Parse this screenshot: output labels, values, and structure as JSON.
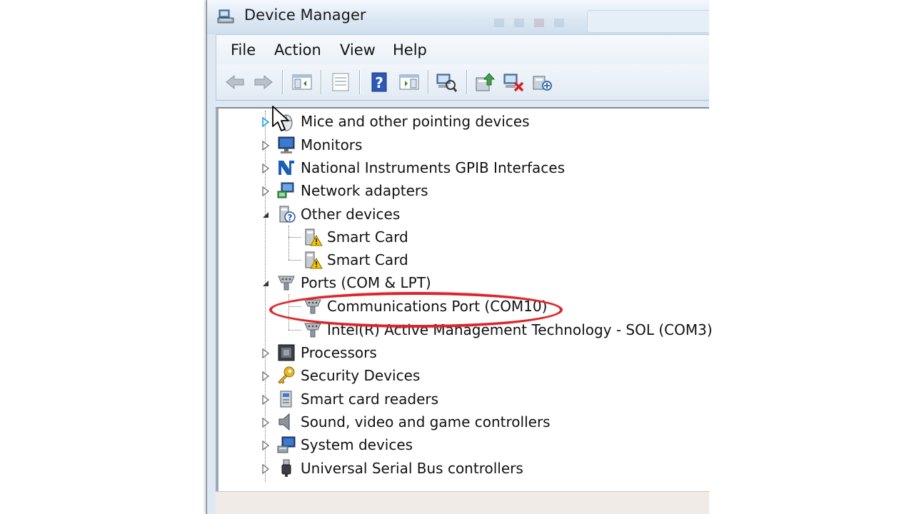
{
  "window": {
    "title": "Device Manager"
  },
  "menu": [
    "File",
    "Action",
    "View",
    "Help"
  ],
  "toolbar": {
    "buttons": [
      "back-icon",
      "forward-icon",
      "show-hide-console-tree-icon",
      "properties-icon",
      "help-icon",
      "action-pane-icon",
      "scan-hardware-changes-icon",
      "update-driver-icon",
      "disable-device-icon",
      "uninstall-device-icon"
    ]
  },
  "tree": {
    "items": [
      {
        "label": "Mice and other pointing devices",
        "icon": "mouse-icon",
        "expanded": false
      },
      {
        "label": "Monitors",
        "icon": "monitor-icon",
        "expanded": false
      },
      {
        "label": "National Instruments GPIB Interfaces",
        "icon": "ni-logo-icon",
        "expanded": false
      },
      {
        "label": "Network adapters",
        "icon": "network-adapter-icon",
        "expanded": false
      },
      {
        "label": "Other devices",
        "icon": "unknown-device-icon",
        "expanded": true,
        "children": [
          {
            "label": "Smart Card",
            "icon": "warning-device-icon"
          },
          {
            "label": "Smart Card",
            "icon": "warning-device-icon"
          }
        ]
      },
      {
        "label": "Ports (COM & LPT)",
        "icon": "port-icon",
        "expanded": true,
        "children": [
          {
            "label": "Communications Port (COM10)",
            "icon": "port-icon",
            "highlighted": true
          },
          {
            "label": "Intel(R) Active Management Technology - SOL (COM3)",
            "icon": "port-icon"
          }
        ]
      },
      {
        "label": "Processors",
        "icon": "processor-icon",
        "expanded": false
      },
      {
        "label": "Security Devices",
        "icon": "key-icon",
        "expanded": false
      },
      {
        "label": "Smart card readers",
        "icon": "card-reader-icon",
        "expanded": false
      },
      {
        "label": "Sound, video and game controllers",
        "icon": "speaker-icon",
        "expanded": false
      },
      {
        "label": "System devices",
        "icon": "system-device-icon",
        "expanded": false
      },
      {
        "label": "Universal Serial Bus controllers",
        "icon": "usb-icon",
        "expanded": false
      }
    ]
  },
  "colors": {
    "highlight_ring": "#d9262c",
    "expander_hover": "#1e9be0"
  }
}
